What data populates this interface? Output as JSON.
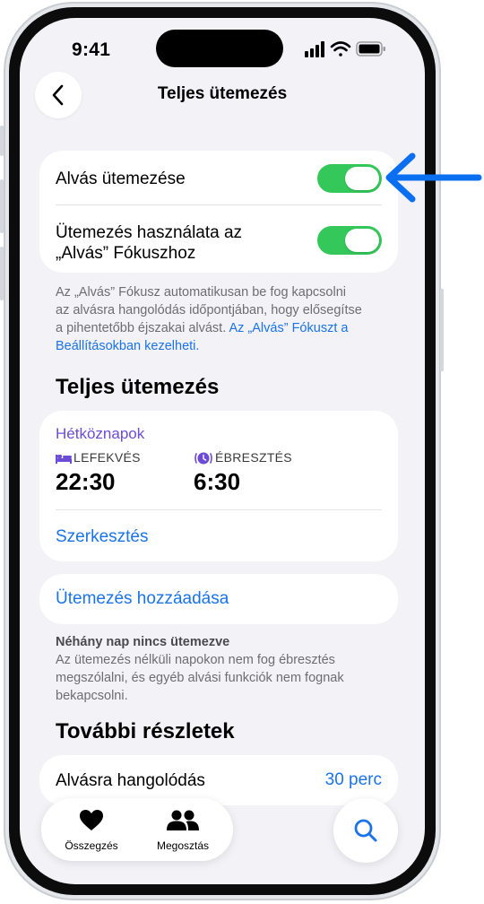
{
  "status_bar": {
    "time": "9:41"
  },
  "header": {
    "title": "Teljes ütemezés"
  },
  "toggles": {
    "sleep_schedule": {
      "label": "Alvás ütemezése",
      "on": true
    },
    "use_for_focus": {
      "label_line1": "Ütemezés használata az",
      "label_line2": "„Alvás” Fókuszhoz",
      "on": true
    }
  },
  "focus_note": {
    "line1": "Az „Alvás” Fókusz automatikusan be fog kapcsolni",
    "line2": "az alvásra hangolódás időpontjában, hogy elősegítse",
    "line3": "a pihentetőbb éjszakai alvást.",
    "link_part1": "Az „Alvás” Fókuszt a",
    "link_part2": "Beállításokban kezelheti."
  },
  "full_schedule": {
    "title": "Teljes ütemezés",
    "group": "Hétköznapok",
    "bedtime_label": "LEFEKVÉS",
    "bedtime_value": "22:30",
    "wake_label": "ÉBRESZTÉS",
    "wake_value": "6:30",
    "edit_label": "Szerkesztés",
    "add_label": "Ütemezés hozzáadása"
  },
  "unscheduled_note": {
    "title": "Néhány nap nincs ütemezve",
    "line1": "Az ütemezés nélküli napokon nem fog ébresztés",
    "line2": "megszólalni, és egyéb alvási funkciók nem fognak",
    "line3": "bekapcsolni."
  },
  "more_details": {
    "title": "További részletek",
    "wind_down_label": "Alvásra hangolódás",
    "wind_down_value": "30 perc"
  },
  "tab_bar": {
    "summary_label": "Összegzés",
    "sharing_label": "Megosztás"
  },
  "colors": {
    "accent_blue": "#1a73e8",
    "toggle_green": "#34c759",
    "purple": "#6c4cd6",
    "arrow_blue": "#0a6ff0"
  },
  "icons": [
    "back-chevron-icon",
    "bed-icon",
    "alarm-icon",
    "heart-icon",
    "people-icon",
    "search-icon",
    "pointer-arrow-icon"
  ]
}
